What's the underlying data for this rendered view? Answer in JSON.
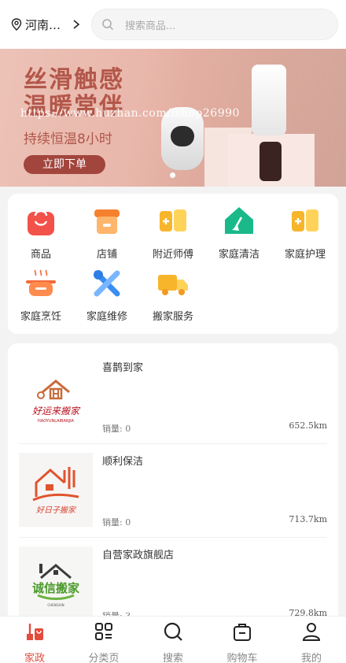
{
  "header": {
    "location": "河南…",
    "search_placeholder": "搜索商品..."
  },
  "banner": {
    "headline_1": "丝滑触感",
    "headline_2": "温暖常伴",
    "watermark": "https://www.huzhan.com/ishop26990",
    "subtitle": "持续恒温8小时",
    "cta": "立即下单"
  },
  "categories": [
    {
      "label": "商品",
      "icon": "shopping-bag-icon"
    },
    {
      "label": "店铺",
      "icon": "store-icon"
    },
    {
      "label": "附近师傅",
      "icon": "map-plus-icon"
    },
    {
      "label": "家庭清洁",
      "icon": "home-broom-icon"
    },
    {
      "label": "家庭护理",
      "icon": "map-plus-icon"
    },
    {
      "label": "家庭烹饪",
      "icon": "cooking-pot-icon"
    },
    {
      "label": "家庭维修",
      "icon": "tools-icon"
    },
    {
      "label": "搬家服务",
      "icon": "truck-icon"
    }
  ],
  "stores": [
    {
      "name": "喜鹊到家",
      "sales": "销量: 0",
      "distance": "652.5km",
      "logo_text": "好运来搬家",
      "logo_sub": "HAOYUNLAIBANJIA"
    },
    {
      "name": "顺利保洁",
      "sales": "销量: 0",
      "distance": "713.7km",
      "logo_text": "好日子搬家",
      "logo_sub": ""
    },
    {
      "name": "自营家政旗舰店",
      "sales": "销量: 3",
      "distance": "729.8km",
      "logo_text": "诚信搬家",
      "logo_sub": "CHENGXIN"
    }
  ],
  "tabbar": [
    {
      "label": "家政",
      "icon": "home-service-icon",
      "active": true
    },
    {
      "label": "分类页",
      "icon": "grid-icon",
      "active": false
    },
    {
      "label": "搜索",
      "icon": "search-icon",
      "active": false
    },
    {
      "label": "购物车",
      "icon": "cart-icon",
      "active": false
    },
    {
      "label": "我的",
      "icon": "user-icon",
      "active": false
    }
  ],
  "colors": {
    "accent": "#e34b3c",
    "banner_text": "#b3574a",
    "cta_bg": "#a2453d"
  }
}
